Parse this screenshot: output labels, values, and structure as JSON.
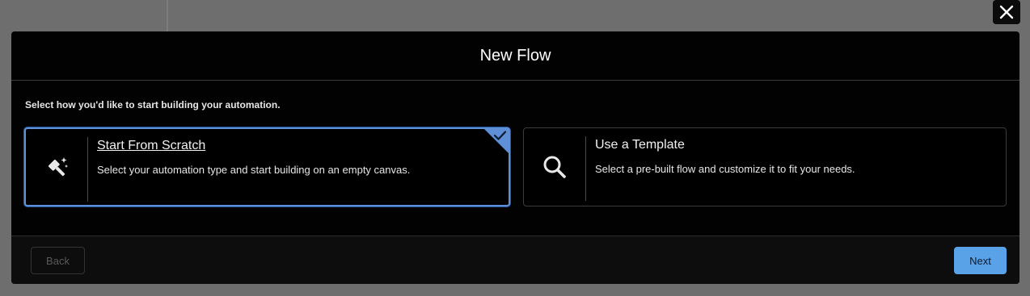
{
  "modal": {
    "title": "New Flow",
    "instruction": "Select how you'd like to start building your automation."
  },
  "options": [
    {
      "title": "Start From Scratch",
      "description": "Select your automation type and start building on an empty canvas.",
      "icon": "magic-wand-icon",
      "selected": true
    },
    {
      "title": "Use a Template",
      "description": "Select a pre-built flow and customize it to fit your needs.",
      "icon": "search-icon",
      "selected": false
    }
  ],
  "footer": {
    "back_label": "Back",
    "next_label": "Next"
  },
  "colors": {
    "accent": "#5aa2e8",
    "selected_border": "#5f8fd6",
    "modal_bg": "#020202",
    "backdrop": "#6e6e6e"
  }
}
